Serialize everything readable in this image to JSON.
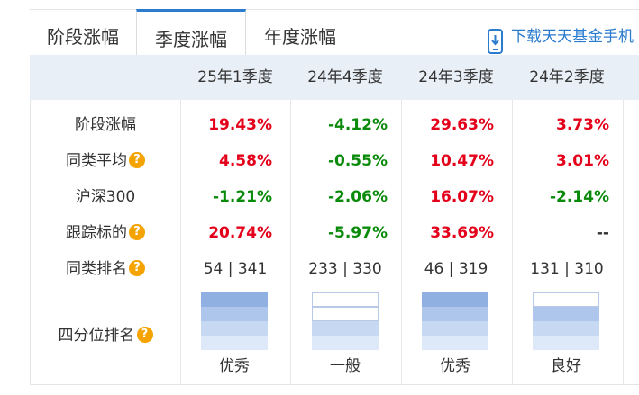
{
  "tabs": [
    {
      "label": "阶段涨幅",
      "active": false
    },
    {
      "label": "季度涨幅",
      "active": true
    },
    {
      "label": "年度涨幅",
      "active": false
    }
  ],
  "download": {
    "label": "下载天天基金手机"
  },
  "columns": [
    "25年1季度",
    "24年4季度",
    "24年3季度",
    "24年2季度"
  ],
  "rows": [
    {
      "label": "阶段涨幅",
      "help": false,
      "values": [
        "19.43%",
        "-4.12%",
        "29.63%",
        "3.73%"
      ]
    },
    {
      "label": "同类平均",
      "help": true,
      "values": [
        "4.58%",
        "-0.55%",
        "10.47%",
        "3.01%"
      ]
    },
    {
      "label": "沪深300",
      "help": false,
      "values": [
        "-1.21%",
        "-2.06%",
        "16.07%",
        "-2.14%"
      ]
    },
    {
      "label": "跟踪标的",
      "help": true,
      "values": [
        "20.74%",
        "-5.97%",
        "33.69%",
        "--"
      ]
    },
    {
      "label": "同类排名",
      "help": true,
      "values": [
        "54 | 341",
        "233 | 330",
        "46 | 319",
        "131 | 310"
      ]
    }
  ],
  "quartile": {
    "label": "四分位排名",
    "help": true,
    "levels": [
      4,
      2,
      4,
      3
    ],
    "ratings": [
      "优秀",
      "一般",
      "优秀",
      "良好"
    ]
  },
  "help_glyph": "?",
  "colors": {
    "positive": "#e4001a",
    "negative": "#0a8a0a",
    "accent": "#2b7ccf",
    "help_badge": "#f4a300"
  }
}
